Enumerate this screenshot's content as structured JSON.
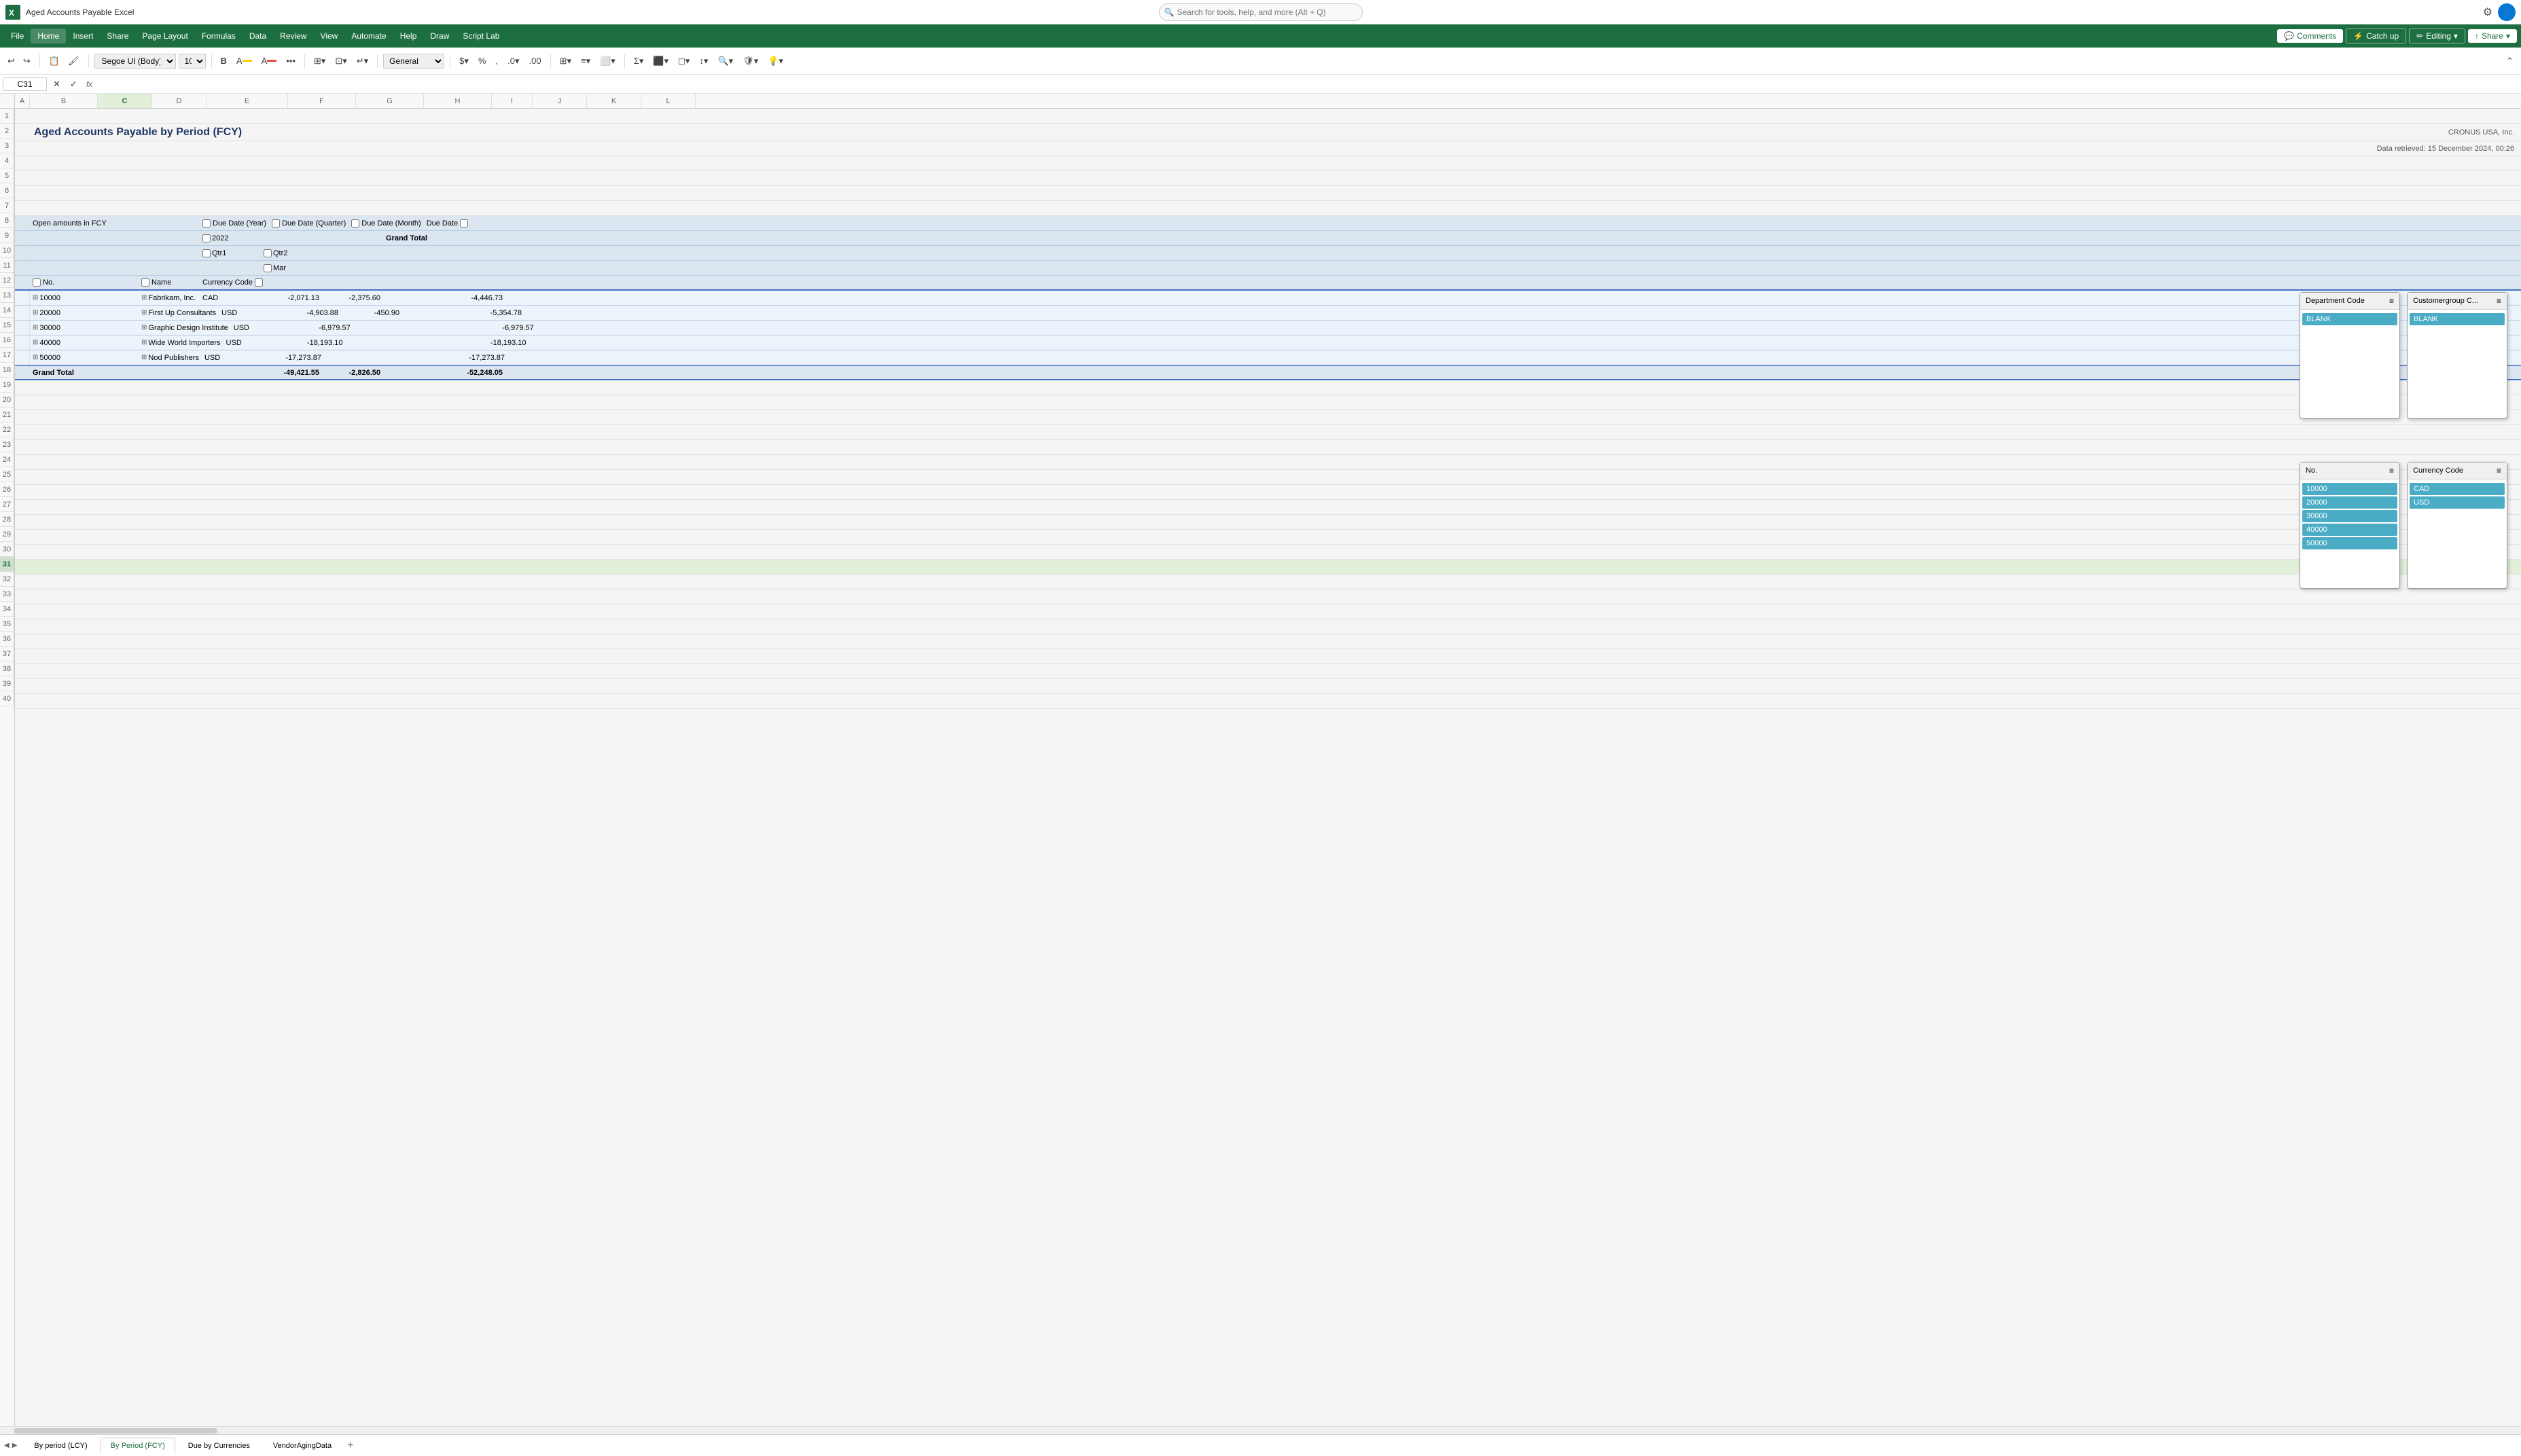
{
  "app": {
    "title": "Aged Accounts Payable Excel",
    "icon_letter": "X"
  },
  "search": {
    "placeholder": "Search for tools, help, and more (Alt + Q)"
  },
  "menu": {
    "items": [
      "File",
      "Home",
      "Insert",
      "Share",
      "Page Layout",
      "Formulas",
      "Data",
      "Review",
      "View",
      "Automate",
      "Help",
      "Draw",
      "Script Lab"
    ],
    "active": "Home"
  },
  "header_buttons": {
    "comments": "Comments",
    "catchup": "Catch up",
    "editing": "Editing",
    "share": "Share"
  },
  "formula_bar": {
    "cell_ref": "C31",
    "fx": "fx"
  },
  "toolbar": {
    "font_family": "Segoe UI (Body)",
    "font_size": "10",
    "format": "General"
  },
  "columns": [
    "A",
    "B",
    "C",
    "D",
    "E",
    "F",
    "G",
    "H",
    "I",
    "J",
    "K",
    "L"
  ],
  "rows": [
    1,
    2,
    3,
    4,
    5,
    6,
    7,
    8,
    9,
    10,
    11,
    12,
    13,
    14,
    15,
    16,
    17,
    18,
    19,
    20,
    21,
    22,
    23,
    24,
    25,
    26,
    27,
    28,
    29,
    30,
    31,
    32,
    33,
    34,
    35,
    36,
    37,
    38,
    39,
    40
  ],
  "report": {
    "title": "Aged Accounts Payable by Period (FCY)",
    "company": "CRONUS USA, Inc.",
    "data_retrieved": "Data retrieved: 15 December 2024, 00:26"
  },
  "pivot_table": {
    "filter_row_label": "Open amounts in FCY",
    "col_headers": [
      "No.",
      "",
      "Name",
      "",
      "Currency Code",
      "",
      "",
      "",
      "",
      "",
      "",
      ""
    ],
    "date_headers": {
      "due_date_year": "Due Date (Year)",
      "due_date_quarter": "Due Date (Quarter)",
      "due_date_month": "Due Date (Month)",
      "due_date": "Due Date"
    },
    "period_labels": {
      "y2022": "2022",
      "q_qtr1": "Qtr1",
      "q_qtr2": "Qtr2",
      "m_mar": "Mar"
    },
    "grand_total": "Grand Total",
    "rows": [
      {
        "no": "10000",
        "name": "Fabrikam, Inc.",
        "currency": "CAD",
        "col1": "-2,071.13",
        "col2": "-2,375.60",
        "col3": "-4,446.73"
      },
      {
        "no": "20000",
        "name": "First Up Consultants",
        "currency": "USD",
        "col1": "-4,903.88",
        "col2": "-450.90",
        "col3": "-5,354.78"
      },
      {
        "no": "30000",
        "name": "Graphic Design Institute",
        "currency": "USD",
        "col1": "-6,979.57",
        "col2": "",
        "col3": "-6,979.57"
      },
      {
        "no": "40000",
        "name": "Wide World Importers",
        "currency": "USD",
        "col1": "-18,193.10",
        "col2": "",
        "col3": "-18,193.10"
      },
      {
        "no": "50000",
        "name": "Nod Publishers",
        "currency": "USD",
        "col1": "-17,273.87",
        "col2": "",
        "col3": "-17,273.87"
      },
      {
        "no": "Grand Total",
        "name": "",
        "currency": "",
        "col1": "-49,421.55",
        "col2": "-2,826.50",
        "col3": "-52,248.05"
      }
    ]
  },
  "slicers": {
    "dept_code": {
      "title": "Department Code",
      "items": [
        "BLANK"
      ],
      "selected": [
        "BLANK"
      ]
    },
    "customer_group": {
      "title": "Customergroup C...",
      "items": [
        "BLANK"
      ],
      "selected": [
        "BLANK"
      ]
    },
    "no": {
      "title": "No.",
      "items": [
        "10000",
        "20000",
        "30000",
        "40000",
        "50000"
      ],
      "selected": [
        "10000",
        "20000",
        "30000",
        "40000",
        "50000"
      ]
    },
    "currency_code": {
      "title": "Currency Code",
      "items": [
        "CAD",
        "USD"
      ],
      "selected": [
        "CAD",
        "USD"
      ]
    }
  },
  "sheet_tabs": [
    {
      "label": "By period (LCY)",
      "active": false
    },
    {
      "label": "By Period (FCY)",
      "active": true
    },
    {
      "label": "Due by Currencies",
      "active": false
    },
    {
      "label": "VendorAgingData",
      "active": false
    }
  ]
}
